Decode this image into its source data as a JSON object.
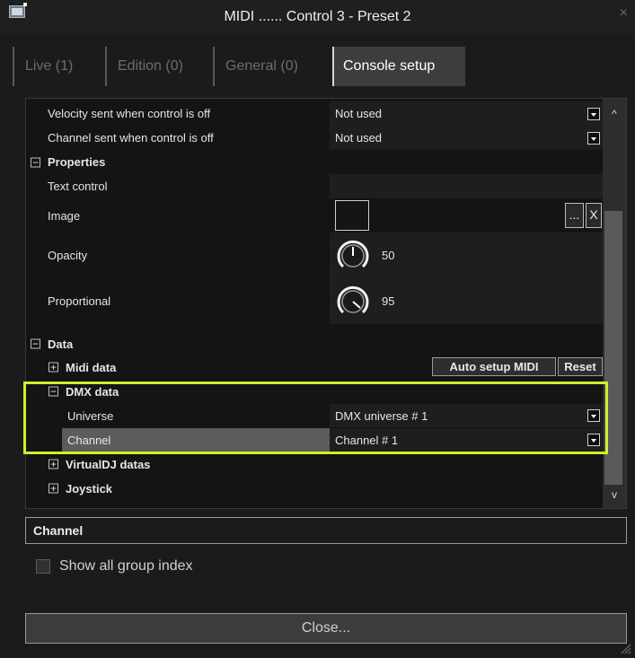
{
  "window": {
    "title": "MIDI ...... Control 3 - Preset 2",
    "close_glyph": "×"
  },
  "tabs": [
    {
      "label": "Live (1)",
      "active": false
    },
    {
      "label": "Edition (0)",
      "active": false
    },
    {
      "label": "General (0)",
      "active": false
    },
    {
      "label": "Console setup",
      "active": true
    }
  ],
  "grid": {
    "velocity_off": {
      "label": "Velocity sent when control is off",
      "value": "Not used"
    },
    "channel_off": {
      "label": "Channel sent when control is off",
      "value": "Not used"
    },
    "properties": {
      "label": "Properties",
      "expander": "−"
    },
    "text_control": {
      "label": "Text control",
      "value": ""
    },
    "image": {
      "label": "Image",
      "browse": "...",
      "clear": "X"
    },
    "opacity": {
      "label": "Opacity",
      "value": "50",
      "level": 50
    },
    "proportional": {
      "label": "Proportional",
      "value": "95",
      "level": 95
    },
    "data": {
      "label": "Data",
      "expander": "−"
    },
    "midi_data": {
      "label": "Midi data",
      "expander": "+",
      "auto_setup": "Auto setup MIDI",
      "reset": "Reset"
    },
    "dmx_data": {
      "label": "DMX data",
      "expander": "−"
    },
    "universe": {
      "label": "Universe",
      "value": "DMX universe # 1"
    },
    "channel": {
      "label": "Channel",
      "value": "Channel # 1"
    },
    "virtualdj": {
      "label": "VirtualDJ datas",
      "expander": "+"
    },
    "joystick": {
      "label": "Joystick",
      "expander": "+"
    }
  },
  "scrollbar": {
    "up": "^",
    "down": "v"
  },
  "description": {
    "title": "Channel"
  },
  "options": {
    "show_all_group_index": "Show all group index",
    "checked": false
  },
  "footer": {
    "close": "Close..."
  },
  "colors": {
    "highlight": "#d4ec2a",
    "background": "#1b1b1b",
    "active_tab": "#3d3d3d"
  }
}
